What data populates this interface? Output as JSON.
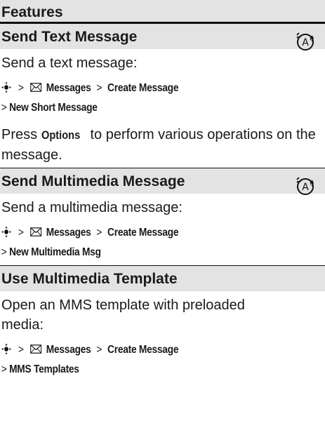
{
  "header": {
    "title": "Features"
  },
  "features": [
    {
      "title": "Send Text Message",
      "intro": "Send a text message:",
      "path_line1": {
        "sep1": ">",
        "menu1": "Messages",
        "sep2": ">",
        "menu2": "Create Message"
      },
      "path_line2": {
        "sep": ">",
        "menu": "New Short Message"
      },
      "note": {
        "prefix": "Press ",
        "key": "Options",
        "suffix": " to perform various operations on the message."
      }
    },
    {
      "title": "Send Multimedia Message",
      "intro": "Send a multimedia message:",
      "path_line1": {
        "sep1": ">",
        "menu1": "Messages",
        "sep2": ">",
        "menu2": "Create Message"
      },
      "path_line2": {
        "sep": ">",
        "menu": "New Multimedia Msg"
      }
    },
    {
      "title": "Use Multimedia Template",
      "intro": "Open an MMS template with preloaded media:",
      "path_line1": {
        "sep1": ">",
        "menu1": "Messages",
        "sep2": ">",
        "menu2": "Create Message"
      },
      "path_line2": {
        "sep": ">",
        "menu": "MMS Templates"
      }
    }
  ]
}
